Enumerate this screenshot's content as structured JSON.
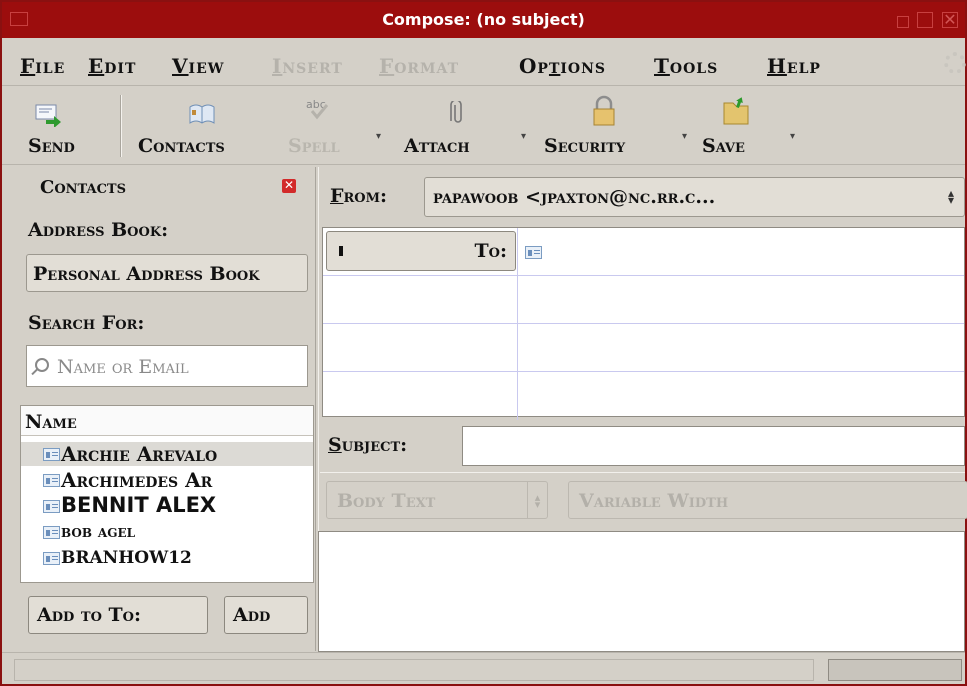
{
  "window": {
    "title": "Compose: (no subject)"
  },
  "menu": {
    "file": {
      "first": "F",
      "rest": "ile"
    },
    "edit": {
      "first": "E",
      "rest": "dit"
    },
    "view": {
      "first": "V",
      "rest": "iew"
    },
    "insert": {
      "first": "I",
      "rest": "nsert"
    },
    "format": {
      "first": "F",
      "rest": "ormat"
    },
    "options": {
      "pre": "Op",
      "acc": "t",
      "rest": "ions"
    },
    "tools": {
      "first": "T",
      "rest": "ools"
    },
    "help": {
      "first": "H",
      "rest": "elp"
    }
  },
  "toolbar": {
    "send": "Send",
    "contacts": "Contacts",
    "spell": "Spell",
    "attach": "Attach",
    "security": "Security",
    "save": "Save"
  },
  "sidebar": {
    "title": "Contacts",
    "address_book_label": "Address Book:",
    "address_book_value": "Personal Address Book",
    "search_label": "Search For:",
    "search_placeholder": "Name or Email",
    "column_name": "Name",
    "contacts": [
      {
        "name": "Archie Arevalo"
      },
      {
        "name": "Archimedes Ar"
      },
      {
        "name": "BENNIT ALEX"
      },
      {
        "name": "bob agel"
      },
      {
        "name": "BRANHOW12"
      }
    ],
    "add_to_label": "Add to To:",
    "add_cc_label": "Add"
  },
  "header": {
    "from_label": "From:",
    "from_value": "papawoob <jpaxton@nc.rr.c...",
    "to_label": "To:",
    "subject_label": "Subject:",
    "subject_value": ""
  },
  "formatbar": {
    "paragraph": "Body Text",
    "font": "Variable Width"
  },
  "status": {
    "text": ""
  }
}
